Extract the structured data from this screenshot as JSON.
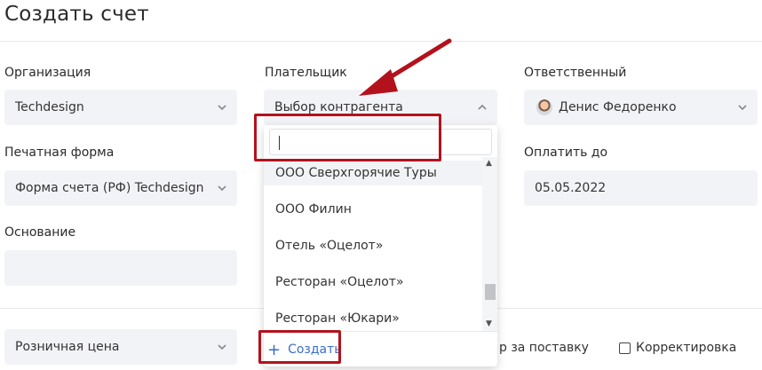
{
  "page": {
    "title": "Создать счет"
  },
  "form": {
    "organization": {
      "label": "Организация",
      "value": "Techdesign"
    },
    "payer": {
      "label": "Плательщик",
      "placeholder": "Выбор контрагента"
    },
    "responsible": {
      "label": "Ответственный",
      "value": "Денис Федоренко"
    },
    "print_form": {
      "label": "Печатная форма",
      "value": "Форма счета (РФ) Techdesign"
    },
    "pay_until": {
      "label": "Оплатить до",
      "value": "05.05.2022"
    },
    "basis": {
      "label": "Основание",
      "value": ""
    },
    "price_type": {
      "value": "Розничная цена"
    },
    "supply_contract": {
      "label": "р за поставку"
    },
    "correction": {
      "label": "Корректировка"
    }
  },
  "dropdown": {
    "search_value": "",
    "items": [
      "ООО Сверхгорячие Туры",
      "ООО Филин",
      "Отель «Оцелот»",
      "Ресторан «Оцелот»",
      "Ресторан «Юкари»"
    ],
    "create_label": "Создать",
    "scroll_up": "▲",
    "scroll_down": "▼"
  },
  "icons": {
    "chevron": "chevron-down-icon",
    "chevron_up": "chevron-up-icon",
    "plus": "+",
    "annotation_color": "#b3121c"
  }
}
